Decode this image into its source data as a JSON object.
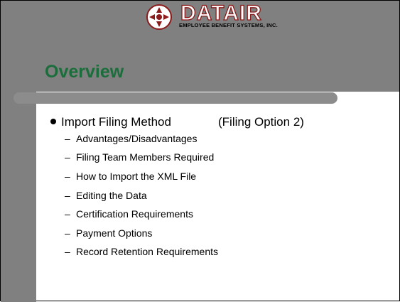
{
  "logo": {
    "wordmark": "DATAIR",
    "subtitle": "EMPLOYEE BENEFIT SYSTEMS, INC."
  },
  "title": "Overview",
  "bullet": {
    "label": "Import Filing Method",
    "option": "(Filing Option 2)"
  },
  "subitems": [
    {
      "dash": "–",
      "label": "Advantages/Disadvantages"
    },
    {
      "dash": "–",
      "label": "Filing Team Members Required"
    },
    {
      "dash": "–",
      "label": "How to Import the XML File"
    },
    {
      "dash": "–",
      "label": "Editing the Data"
    },
    {
      "dash": "–",
      "label": "Certification Requirements"
    },
    {
      "dash": "–",
      "label": "Payment Options"
    },
    {
      "dash": "–",
      "label": "Record Retention Requirements"
    }
  ],
  "colors": {
    "band": "#808080",
    "divider": "#8c8c8c",
    "title": "#1b6e3b",
    "logo_accent": "#8b1a1a"
  }
}
